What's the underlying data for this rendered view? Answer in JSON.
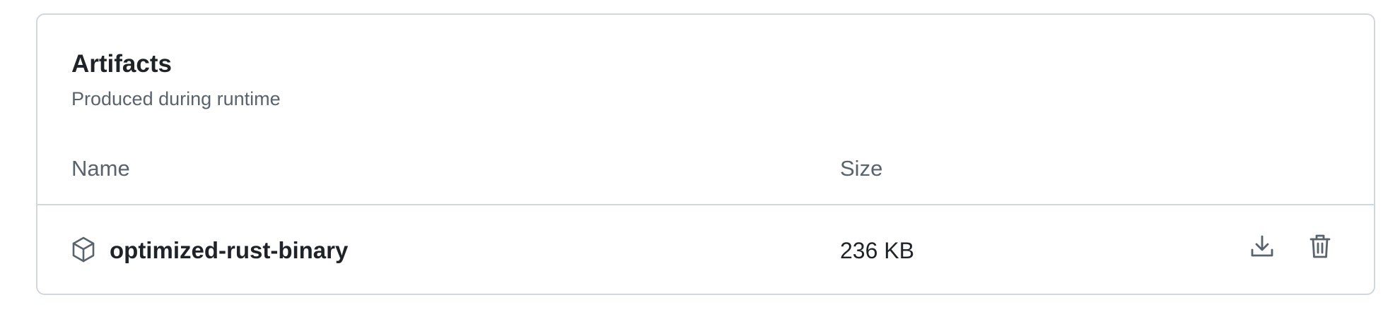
{
  "artifacts": {
    "title": "Artifacts",
    "subtitle": "Produced during runtime",
    "columns": {
      "name": "Name",
      "size": "Size"
    },
    "items": [
      {
        "name": "optimized-rust-binary",
        "size": "236 KB",
        "icon": "package-icon"
      }
    ],
    "actions": [
      "download-icon",
      "trash-icon"
    ]
  },
  "colors": {
    "border": "#d0d7de",
    "text_primary": "#1f2328",
    "text_muted": "#59636e"
  }
}
